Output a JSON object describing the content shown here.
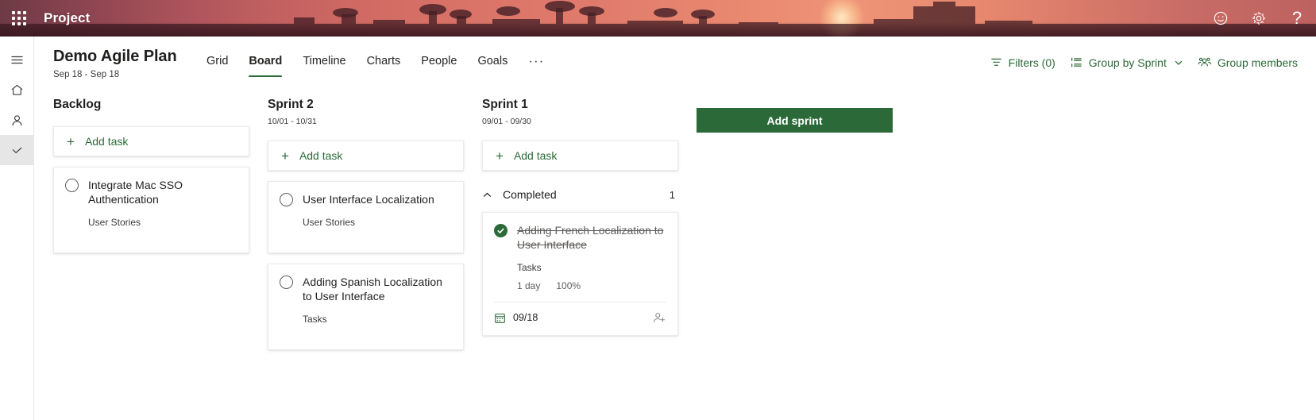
{
  "suite": {
    "waffle_label": "App launcher",
    "title": "Project",
    "actions": [
      {
        "name": "feedback-icon",
        "label": "Feedback"
      },
      {
        "name": "settings-icon",
        "label": "Settings"
      },
      {
        "name": "help-icon",
        "label": "Help"
      }
    ]
  },
  "rail": {
    "items": [
      {
        "name": "hamburger-icon",
        "label": "Menu",
        "selected": false
      },
      {
        "name": "home-icon",
        "label": "Home",
        "selected": false
      },
      {
        "name": "person-icon",
        "label": "My tasks",
        "selected": false
      },
      {
        "name": "checkmark-icon",
        "label": "Projects",
        "selected": true
      }
    ]
  },
  "header": {
    "title": "Demo Agile Plan",
    "subtitle": "Sep 18 - Sep 18",
    "tabs": [
      {
        "label": "Grid",
        "active": false
      },
      {
        "label": "Board",
        "active": true
      },
      {
        "label": "Timeline",
        "active": false
      },
      {
        "label": "Charts",
        "active": false
      },
      {
        "label": "People",
        "active": false
      },
      {
        "label": "Goals",
        "active": false
      }
    ],
    "more_label": "···",
    "actions": [
      {
        "label": "Filters (0)",
        "icon": "filter-icon"
      },
      {
        "label": "Group by Sprint",
        "icon": "group-list-icon",
        "chevron": true
      },
      {
        "label": "Group members",
        "icon": "people-icon"
      }
    ]
  },
  "board": {
    "add_task_label": "Add task",
    "add_sprint_label": "Add sprint",
    "columns": [
      {
        "name": "Backlog",
        "dates": "",
        "cards": [
          {
            "title": "Integrate Mac SSO Authentication",
            "bucket": "User Stories",
            "done": false,
            "duration": "",
            "percent": "",
            "date": "",
            "has_footer": false
          }
        ],
        "groups": []
      },
      {
        "name": "Sprint 2",
        "dates": "10/01 - 10/31",
        "cards": [
          {
            "title": "User Interface Localization",
            "bucket": "User Stories",
            "done": false,
            "duration": "",
            "percent": "",
            "date": "",
            "has_footer": false
          },
          {
            "title": "Adding Spanish Localization to User Interface",
            "bucket": "Tasks",
            "done": false,
            "duration": "",
            "percent": "",
            "date": "",
            "has_footer": false
          }
        ],
        "groups": []
      },
      {
        "name": "Sprint 1",
        "dates": "09/01 - 09/30",
        "cards": [],
        "groups": [
          {
            "label": "Completed",
            "count": "1",
            "expanded": true,
            "cards": [
              {
                "title": "Adding French Localization to User Interface",
                "bucket": "Tasks",
                "done": true,
                "duration": "1 day",
                "percent": "100%",
                "date": "09/18",
                "has_footer": true
              }
            ]
          }
        ]
      }
    ]
  },
  "colors": {
    "accent_green": "#2b6a38",
    "suite_bar_tint": "#b45a5c",
    "text_primary": "#201f1e",
    "text_secondary": "#3b3a39",
    "card_border": "#edebe9"
  }
}
